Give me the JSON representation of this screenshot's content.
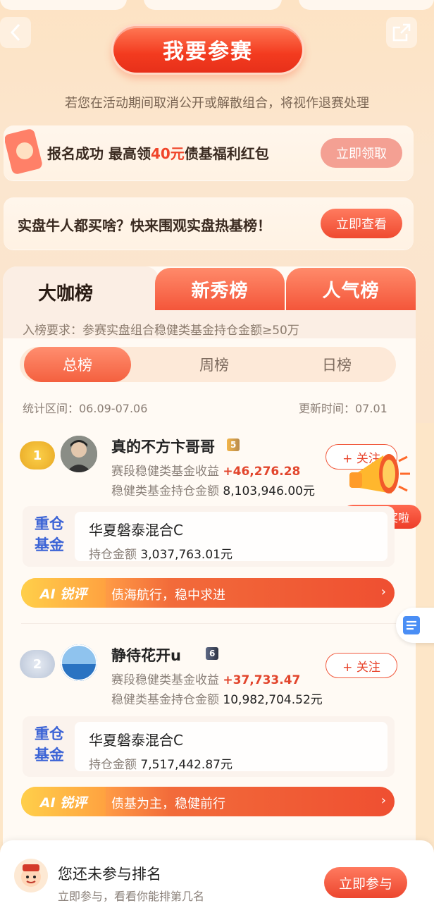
{
  "header": {
    "back_icon": "chevron-left-icon",
    "share_icon": "share-icon",
    "join_button_label": "我要参赛",
    "notice": "若您在活动期间取消公开或解散组合，将视作退赛处理"
  },
  "banner_reward": {
    "text_before": "报名成功 最高领",
    "amount": "40元",
    "text_after": "债基福利红包",
    "button_label": "立即领取"
  },
  "banner_hot": {
    "text": "实盘牛人都买啥？快来围观实盘热基榜！",
    "button_label": "立即查看"
  },
  "leaderboard": {
    "tabs": [
      {
        "label": "大咖榜",
        "active": true
      },
      {
        "label": "新秀榜",
        "active": false
      },
      {
        "label": "人气榜",
        "active": false
      }
    ],
    "requirement": "入榜要求：参赛实盘组合稳健类基金持仓金额≥50万",
    "periods": [
      {
        "label": "总榜",
        "active": true
      },
      {
        "label": "周榜",
        "active": false
      },
      {
        "label": "日榜",
        "active": false
      }
    ],
    "stat_range": "统计区间：06.09-07.06",
    "update_time": "更新时间：07.01",
    "entries": [
      {
        "rank": "1",
        "name": "真的不方卞哥哥",
        "level": "5",
        "income_label": "赛段稳健类基金收益",
        "income_value": "+46,276.28",
        "hold_label": "稳健类基金持仓金额",
        "hold_value": "8,103,946.00元",
        "follow_label": "+ 关注",
        "fund_tag": "重仓基金",
        "fund_name": "华夏磐泰混合C",
        "fund_hold_label": "持仓金额",
        "fund_hold_value": "3,037,763.01元",
        "ai_tag": "AI 锐评",
        "ai_comment": "债海航行，稳中求进"
      },
      {
        "rank": "2",
        "name": "静待花开u",
        "level": "6",
        "income_label": "赛段稳健类基金收益",
        "income_value": "+37,733.47",
        "hold_label": "稳健类基金持仓金额",
        "hold_value": "10,982,704.52元",
        "follow_label": "+ 关注",
        "fund_tag": "重仓基金",
        "fund_name": "华夏磐泰混合C",
        "fund_hold_label": "持仓金额",
        "fund_hold_value": "7,517,442.87元",
        "ai_tag": "AI 锐评",
        "ai_comment": "债基为主，稳健前行"
      }
    ]
  },
  "promo_bubble": "放榜发奖啦",
  "bottom_bar": {
    "title": "您还未参与排名",
    "subtitle": "立即参与，看看你能排第几名",
    "button_label": "立即参与"
  },
  "colors": {
    "accent": "#f0452a",
    "background": "#fde6c8",
    "fund_tag": "#3c64d6"
  }
}
